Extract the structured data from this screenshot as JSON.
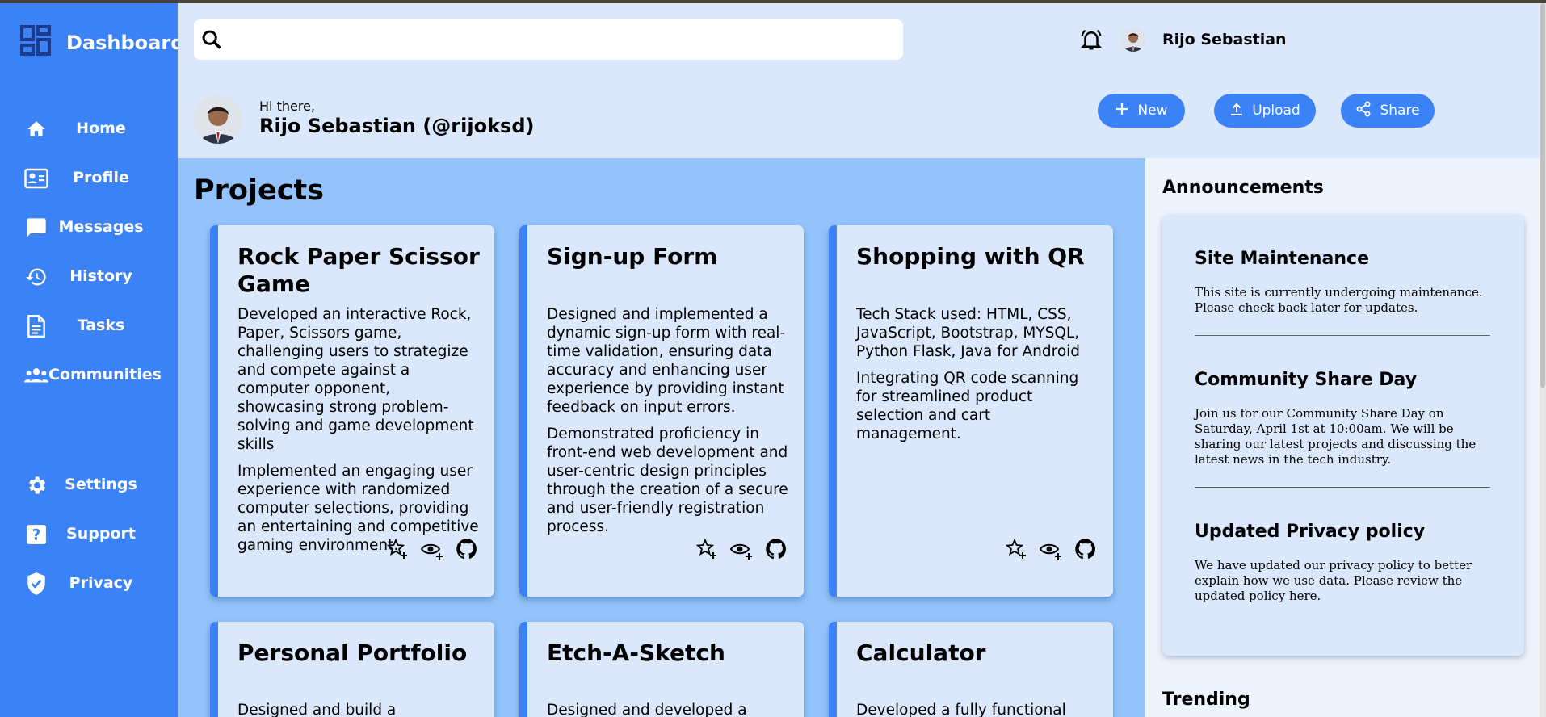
{
  "sidebar": {
    "brand": "Dashboard",
    "items": [
      {
        "label": "Home",
        "icon": "home-icon"
      },
      {
        "label": "Profile",
        "icon": "id-card-icon"
      },
      {
        "label": "Messages",
        "icon": "chat-icon"
      },
      {
        "label": "History",
        "icon": "history-icon"
      },
      {
        "label": "Tasks",
        "icon": "document-icon"
      },
      {
        "label": "Communities",
        "icon": "group-icon"
      }
    ],
    "bottom_items": [
      {
        "label": "Settings",
        "icon": "gear-icon"
      },
      {
        "label": "Support",
        "icon": "help-icon"
      },
      {
        "label": "Privacy",
        "icon": "shield-check-icon"
      }
    ]
  },
  "header": {
    "search_placeholder": "",
    "user_name": "Rijo Sebastian",
    "greeting": "Hi there,",
    "handle": "Rijo Sebastian (@rijoksd)",
    "buttons": {
      "new": "New",
      "upload": "Upload",
      "share": "Share"
    }
  },
  "main": {
    "title": "Projects",
    "projects": [
      {
        "title": "Rock Paper Scissor Game",
        "paragraphs": [
          "Developed an interactive Rock, Paper, Scissors game, challenging users to strategize and compete against a computer opponent, showcasing strong problem-solving and game development skills",
          "Implemented an engaging user experience with randomized computer selections, providing an entertaining and competitive gaming environment."
        ]
      },
      {
        "title": "Sign-up Form",
        "paragraphs": [
          "Designed and implemented a dynamic sign-up form with real-time validation, ensuring data accuracy and enhancing user experience by providing instant feedback on input errors.",
          "Demonstrated proficiency in front-end web development and user-centric design principles through the creation of a secure and user-friendly registration process."
        ]
      },
      {
        "title": "Shopping with QR",
        "paragraphs": [
          "Tech Stack used: HTML, CSS, JavaScript, Bootstrap, MYSQL, Python Flask, Java for Android",
          "Integrating QR code scanning for streamlined product selection and cart management."
        ]
      },
      {
        "title": "Personal Portfolio",
        "paragraphs": [
          "Designed and build a captivating"
        ]
      },
      {
        "title": "Etch-A-Sketch",
        "paragraphs": [
          "Designed and developed a digital"
        ]
      },
      {
        "title": "Calculator",
        "paragraphs": [
          "Developed a fully functional"
        ]
      }
    ]
  },
  "announcements": {
    "title": "Announcements",
    "items": [
      {
        "title": "Site Maintenance",
        "text": "This site is currently undergoing maintenance. Please check back later for updates."
      },
      {
        "title": "Community Share Day",
        "text": "Join us for our Community Share Day on Saturday, April 1st at 10:00am. We will be sharing our latest projects and discussing the latest news in the tech industry."
      },
      {
        "title": "Updated Privacy policy",
        "text": "We have updated our privacy policy to better explain how we use data. Please review the updated policy here."
      }
    ]
  },
  "trending": {
    "title": "Trending"
  },
  "colors": {
    "sidebar": "#3b82f6",
    "header": "#dbe8fc",
    "main": "#93c3fa",
    "panel": "#eef4fd",
    "accent": "#3b82f6"
  }
}
